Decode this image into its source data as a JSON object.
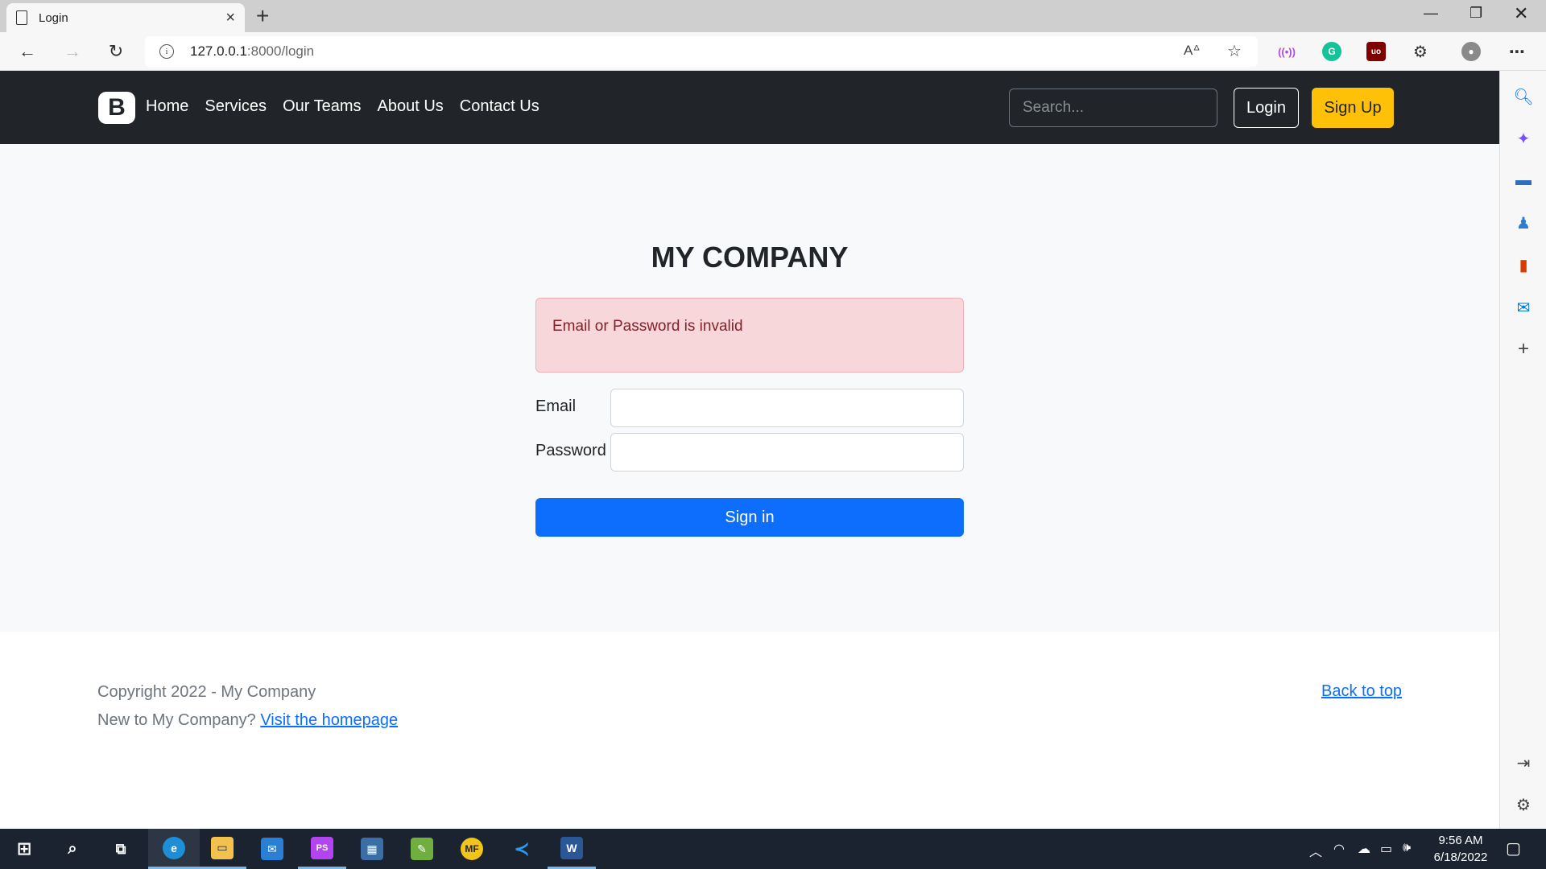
{
  "browser": {
    "tab_title": "Login",
    "url_host": "127.0.0.1",
    "url_path": ":8000/login"
  },
  "navbar": {
    "brand": "B",
    "links": [
      "Home",
      "Services",
      "Our Teams",
      "About Us",
      "Contact Us"
    ],
    "search_placeholder": "Search...",
    "login_label": "Login",
    "signup_label": "Sign Up"
  },
  "login": {
    "heading": "MY COMPANY",
    "alert": "Email or Password is invalid",
    "email_label": "Email",
    "email_value": "",
    "password_label": "Password",
    "password_value": "",
    "submit_label": "Sign in"
  },
  "footer": {
    "copyright": "Copyright 2022 - My Company",
    "new_prompt": "New to My Company?",
    "homepage_link": "Visit the homepage",
    "back_to_top": "Back to top"
  },
  "taskbar": {
    "time": "9:56 AM",
    "date": "6/18/2022"
  },
  "colors": {
    "navbar_bg": "#212529",
    "signup_bg": "#ffc107",
    "primary": "#0d6efd",
    "alert_bg": "#f8d7da",
    "alert_text": "#842029"
  }
}
